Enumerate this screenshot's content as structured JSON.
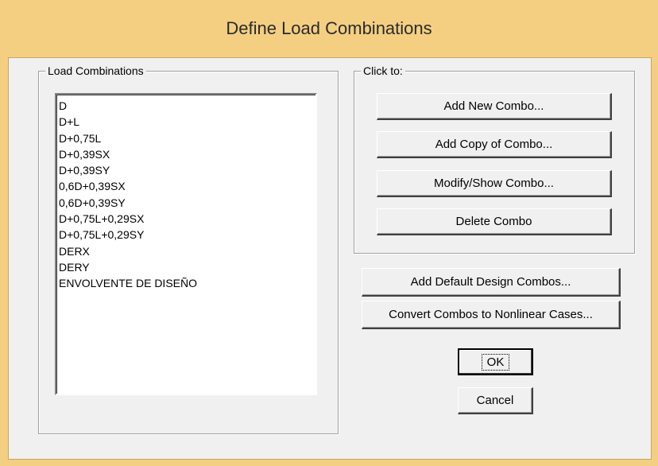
{
  "window": {
    "title": "Define Load Combinations"
  },
  "load_combinations": {
    "label": "Load Combinations",
    "items": [
      "D",
      "D+L",
      "D+0,75L",
      "D+0,39SX",
      "D+0,39SY",
      "0,6D+0,39SX",
      "0,6D+0,39SY",
      "D+0,75L+0,29SX",
      "D+0,75L+0,29SY",
      "DERX",
      "DERY",
      "ENVOLVENTE DE DISEÑO"
    ]
  },
  "click_to": {
    "label": "Click to:",
    "add_new": "Add New Combo...",
    "add_copy": "Add Copy of Combo...",
    "modify_show": "Modify/Show Combo...",
    "delete": "Delete Combo"
  },
  "actions": {
    "add_default": "Add Default Design Combos...",
    "convert": "Convert Combos to Nonlinear Cases...",
    "ok": "OK",
    "cancel": "Cancel"
  }
}
